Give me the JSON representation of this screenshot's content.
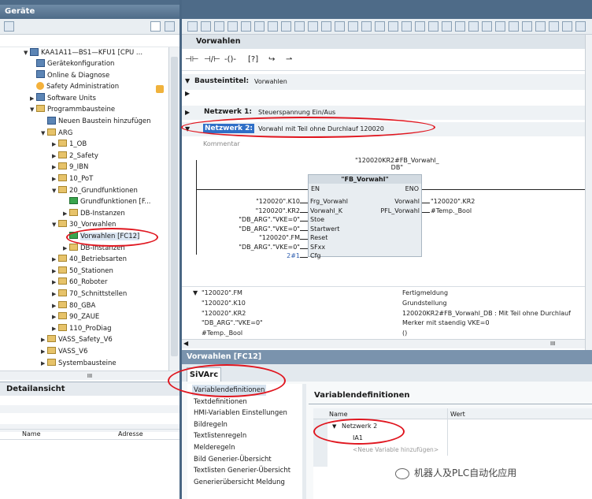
{
  "left": {
    "title": "Geräte",
    "project": "KAA1A11—BS1—KFU1 [CPU ...",
    "items": [
      {
        "t": "Gerätekonfiguration",
        "l": 1,
        "ic": "gic",
        "a": ""
      },
      {
        "t": "Online & Diagnose",
        "l": 1,
        "ic": "gic",
        "a": ""
      },
      {
        "t": "Safety Administration",
        "l": 1,
        "ic": "oic",
        "a": ""
      },
      {
        "t": "Software Units",
        "l": 1,
        "ic": "gic",
        "a": "▶"
      },
      {
        "t": "Programmbausteine",
        "l": 1,
        "ic": "fic",
        "a": "▼"
      },
      {
        "t": "Neuen Baustein hinzufügen",
        "l": 2,
        "ic": "gic",
        "a": ""
      },
      {
        "t": "ARG",
        "l": 2,
        "ic": "fic",
        "a": "▼"
      },
      {
        "t": "1_OB",
        "l": 3,
        "ic": "fic",
        "a": "▶"
      },
      {
        "t": "2_Safety",
        "l": 3,
        "ic": "fic",
        "a": "▶"
      },
      {
        "t": "9_IBN",
        "l": 3,
        "ic": "fic",
        "a": "▶"
      },
      {
        "t": "10_PoT",
        "l": 3,
        "ic": "fic",
        "a": "▶"
      },
      {
        "t": "20_Grundfunktionen",
        "l": 3,
        "ic": "fic",
        "a": "▼"
      },
      {
        "t": "Grundfunktionen [F...",
        "l": 4,
        "ic": "bic",
        "a": ""
      },
      {
        "t": "DB-Instanzen",
        "l": 4,
        "ic": "fic",
        "a": "▶"
      },
      {
        "t": "30_Vorwahlen",
        "l": 3,
        "ic": "fic",
        "a": "▼"
      },
      {
        "t": "Vorwahlen [FC12]",
        "l": 4,
        "ic": "bic",
        "a": ""
      },
      {
        "t": "DB-Instanzen",
        "l": 4,
        "ic": "fic",
        "a": "▶"
      },
      {
        "t": "40_Betriebsarten",
        "l": 3,
        "ic": "fic",
        "a": "▶"
      },
      {
        "t": "50_Stationen",
        "l": 3,
        "ic": "fic",
        "a": "▶"
      },
      {
        "t": "60_Roboter",
        "l": 3,
        "ic": "fic",
        "a": "▶"
      },
      {
        "t": "70_Schnittstellen",
        "l": 3,
        "ic": "fic",
        "a": "▶"
      },
      {
        "t": "80_GBA",
        "l": 3,
        "ic": "fic",
        "a": "▶"
      },
      {
        "t": "90_ZAUE",
        "l": 3,
        "ic": "fic",
        "a": "▶"
      },
      {
        "t": "110_ProDiag",
        "l": 3,
        "ic": "fic",
        "a": "▶"
      },
      {
        "t": "VASS_Safety_V6",
        "l": 2,
        "ic": "fic",
        "a": "▶"
      },
      {
        "t": "VASS_V6",
        "l": 2,
        "ic": "fic",
        "a": "▶"
      },
      {
        "t": "Systembausteine",
        "l": 2,
        "ic": "fic",
        "a": "▶"
      }
    ],
    "detail_title": "Detailansicht",
    "col_name": "Name",
    "col_addr": "Adresse",
    "scroll_mid": "III"
  },
  "editor": {
    "title": "Vorwahlen",
    "block_title_label": "Bausteintitel:",
    "block_title": "Vorwahlen",
    "n1_label": "Netzwerk 1:",
    "n1_text": "Steuerspannung Ein/Aus",
    "n2_label": "Netzwerk 2:",
    "n2_text": "Vorwahl mit Teil ohne Durchlauf 120020",
    "comment": "Kommentar",
    "db_name": "\"120020KR2#FB_Vorwahl_",
    "db_name2": "DB\"",
    "fb": "\"FB_Vorwahl\"",
    "en": "EN",
    "eno": "ENO",
    "inputs": [
      {
        "a": "\"120020\".K10",
        "p": "Frg_Vorwahl"
      },
      {
        "a": "\"120020\".KR2",
        "p": "Vorwahl_K"
      },
      {
        "a": "\"DB_ARG\".\"VKE=0\"",
        "p": "Stoe"
      },
      {
        "a": "\"DB_ARG\".\"VKE=0\"",
        "p": "Startwert"
      },
      {
        "a": "\"120020\".FM",
        "p": "Reset"
      },
      {
        "a": "\"DB_ARG\".\"VKE=0\"",
        "p": "SFxx"
      },
      {
        "a": "2#1",
        "p": "Cfg"
      }
    ],
    "outputs": [
      {
        "p": "Vorwahl",
        "a": "\"120020\".KR2"
      },
      {
        "p": "PFL_Vorwahl",
        "a": "#Temp._Bool"
      }
    ],
    "vars": [
      {
        "n": "\"120020\".FM",
        "d": "Fertigmeldung"
      },
      {
        "n": "\"120020\".K10",
        "d": "Grundstellung"
      },
      {
        "n": "\"120020\".KR2",
        "d": "120020KR2#FB_Vorwahl_DB : Mit Teil ohne Durchlauf"
      },
      {
        "n": "\"DB_ARG\".\"VKE=0\"",
        "d": "Merker mit staendig VKE=0"
      },
      {
        "n": "#Temp._Bool",
        "d": "()"
      }
    ],
    "scroll_mid": "III"
  },
  "bottom": {
    "title": "Vorwahlen [FC12]",
    "tab": "SiVArc",
    "list": [
      "Variablendefinitionen",
      "Textdefinitionen",
      "HMI-Variablen Einstellungen",
      "Bildregeln",
      "Textlistenregeln",
      "Melderegeln",
      "Bild Generier-Übersicht",
      "Textlisten Generier-Übersicht",
      "Generierübersicht Meldung"
    ],
    "vardef_title": "Variablendefinitionen",
    "col_name": "Name",
    "col_wert": "Wert",
    "net": "Netzwerk 2",
    "var": "IA1",
    "add": "<Neue Variable hinzufügen>"
  },
  "watermark": "机器人及PLC自动化应用"
}
